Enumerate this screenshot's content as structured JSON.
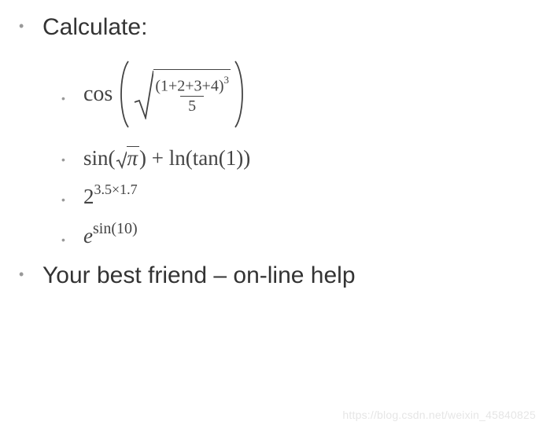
{
  "items": {
    "calculate_label": "Calculate:",
    "friend_label": "Your best friend – on-line help"
  },
  "formulas": {
    "f1": {
      "func": "cos",
      "numerator_base": "(1+2+3+4)",
      "numerator_exp": "3",
      "denominator": "5"
    },
    "f2": {
      "sin": "sin",
      "pi": "π",
      "plus": " + ",
      "ln": "ln",
      "tan": "tan",
      "tan_arg": "1"
    },
    "f3": {
      "base": "2",
      "exp": "3.5×1.7"
    },
    "f4": {
      "base": "e",
      "exp_func": "sin",
      "exp_arg": "10"
    }
  },
  "watermark": "https://blog.csdn.net/weixin_45840825"
}
